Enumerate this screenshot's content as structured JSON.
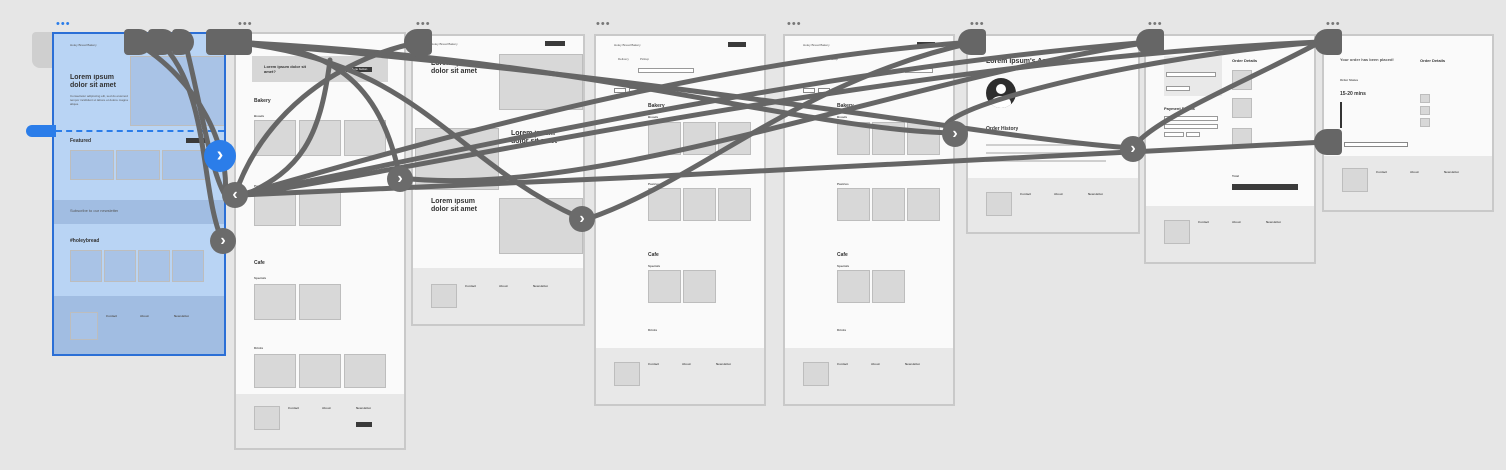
{
  "frames": {
    "home": {
      "hero_title": "Lorem ipsum dolor sit amet",
      "hero_body": "Consectetur adipiscing elit, sed do eiusmod tempor incididunt ut labore et dolore magna aliqua.",
      "nav_brand": "Holey Bread Bakery",
      "featured_title": "Featured",
      "newsletter_title": "Subscribe to our newsletter",
      "hashtag_title": "#holeybread",
      "footer_contact": "Contact",
      "footer_about": "About",
      "footer_newsletter": "Newsletter"
    },
    "menu": {
      "banner_title": "Lorem ipsum dolor sit amet?",
      "banner_btn": "Menu button",
      "bakery_title": "Bakery",
      "breads": "Breads",
      "pastries": "Pastries",
      "cafe_title": "Cafe",
      "specials": "Specials",
      "drinks": "Drinks",
      "footer_contact": "Contact",
      "footer_about": "About",
      "footer_newsletter": "Newsletter"
    },
    "about": {
      "nav_brand": "Holey Bread Bakery",
      "title1": "Lorem ipsum dolor sit amet",
      "title2": "Lorem ipsum dolor sit amet",
      "title3": "Lorem ipsum dolor sit amet",
      "footer_contact": "Contact",
      "footer_about": "About",
      "footer_newsletter": "Newsletter"
    },
    "order1": {
      "nav_brand": "Holey Bread Bakery",
      "tab_delivery": "Delivery",
      "tab_pickup": "Pickup",
      "bakery_title": "Bakery",
      "breads": "Breads",
      "pastries": "Pastries",
      "cafe_title": "Cafe",
      "specials": "Specials",
      "drinks": "Drinks",
      "footer_contact": "Contact",
      "footer_about": "About",
      "footer_newsletter": "Newsletter"
    },
    "order2": {
      "nav_brand": "Holey Bread Bakery",
      "tab_delivery": "Delivery",
      "tab_pickup": "Pickup",
      "bakery_title": "Bakery",
      "breads": "Breads",
      "pastries": "Pastries",
      "cafe_title": "Cafe",
      "specials": "Specials",
      "drinks": "Drinks",
      "footer_contact": "Contact",
      "footer_about": "About",
      "footer_newsletter": "Newsletter"
    },
    "account": {
      "title": "Lorem Ipsum's Account",
      "order_history": "Order History",
      "footer_contact": "Contact",
      "footer_about": "About",
      "footer_newsletter": "Newsletter"
    },
    "checkout": {
      "order_details": "Order Details",
      "payment_details": "Payment Details",
      "total": "Total",
      "footer_contact": "Contact",
      "footer_about": "About",
      "footer_newsletter": "Newsletter"
    },
    "confirm": {
      "placed": "Your order has been placed!",
      "order_status": "Order Status",
      "eta": "15-20 mins",
      "order_details": "Order Details",
      "footer_contact": "Contact",
      "footer_about": "About",
      "footer_newsletter": "Newsletter"
    }
  },
  "colors": {
    "canvas": "#e6e6e6",
    "selection": "#2b7de9",
    "connector": "#666666"
  }
}
